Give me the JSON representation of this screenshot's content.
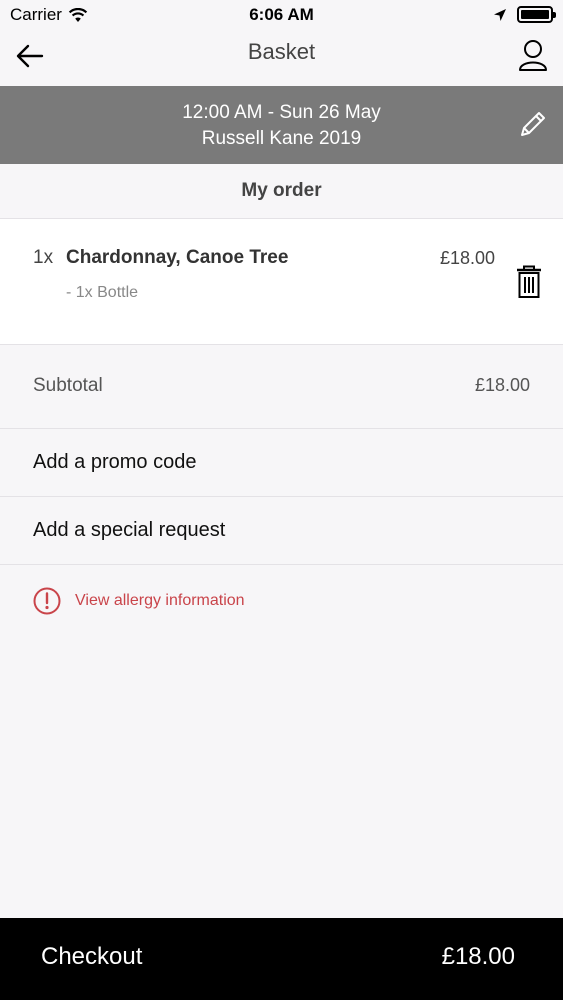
{
  "status_bar": {
    "carrier": "Carrier",
    "time": "6:06 AM",
    "icons": [
      "wifi-icon",
      "location-icon",
      "battery-icon"
    ]
  },
  "nav": {
    "title": "Basket",
    "back_icon": "arrow-left-icon",
    "account_icon": "user-icon"
  },
  "event": {
    "datetime": "12:00 AM - Sun 26 May",
    "name": "Russell Kane 2019",
    "edit_icon": "pencil-icon"
  },
  "order": {
    "header": "My order",
    "items": [
      {
        "qty": "1x",
        "name": "Chardonnay, Canoe Tree",
        "option": "- 1x Bottle",
        "price": "£18.00"
      }
    ]
  },
  "subtotal": {
    "label": "Subtotal",
    "value": "£18.00"
  },
  "actions": {
    "promo_label": "Add a promo code",
    "special_label": "Add a special request"
  },
  "allergy": {
    "label": "View allergy information",
    "color": "#c9444a"
  },
  "checkout": {
    "label": "Checkout",
    "total": "£18.00"
  },
  "colors": {
    "banner": "#7a7a7a",
    "background": "#f7f6f8",
    "checkout_bg": "#000000"
  }
}
